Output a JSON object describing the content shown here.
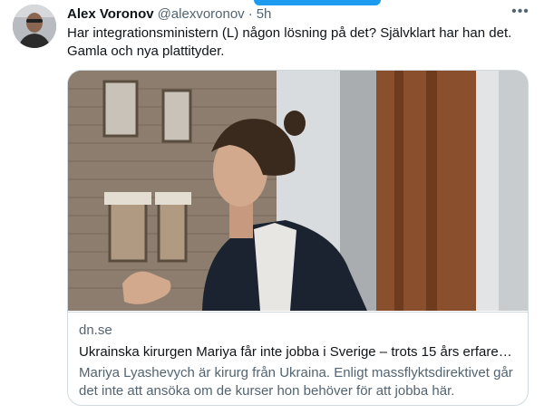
{
  "tweet": {
    "display_name": "Alex Voronov",
    "handle": "@alexvoronov",
    "separator": "·",
    "time": "5h",
    "text": "Har integrationsministern (L) någon lösning på det? Självklart har han det. Gamla och nya plattityder.",
    "more_icon": "more-horizontal-icon"
  },
  "card": {
    "domain": "dn.se",
    "title": "Ukrainska kirurgen Mariya får inte jobba i Sverige – trots 15 års erfare…",
    "description": "Mariya Lyashevych är kirurg från Ukraina. Enligt massflyktsdirektivet går det inte att ansöka om de kurser hon behöver för att jobba här."
  },
  "colors": {
    "accent": "#1d9bf0",
    "text_primary": "#0f1419",
    "text_secondary": "#536471",
    "border": "#cfd9de"
  }
}
